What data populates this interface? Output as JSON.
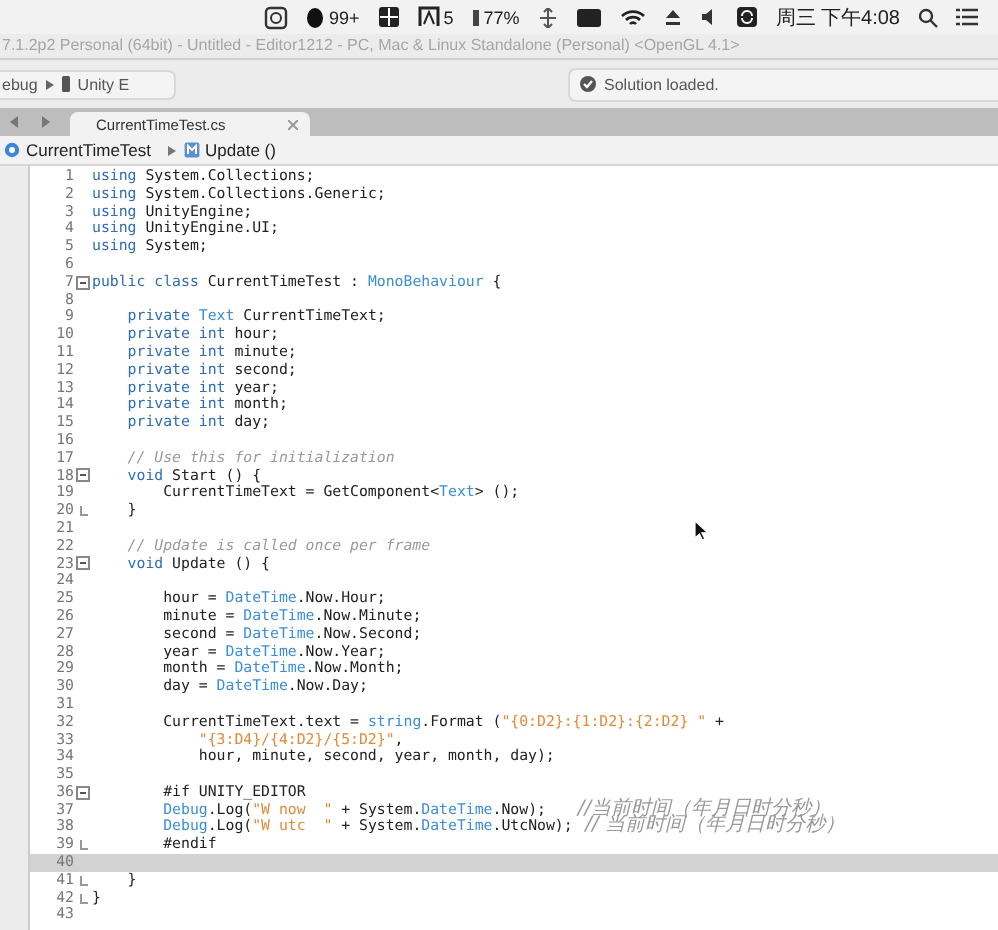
{
  "menubar": {
    "items": [
      {
        "kind": "window"
      },
      {
        "kind": "figure",
        "text": "99+"
      },
      {
        "kind": "grid"
      },
      {
        "kind": "letters",
        "text": "5"
      },
      {
        "kind": "meter",
        "text": "77%"
      },
      {
        "kind": "network"
      },
      {
        "kind": "display"
      },
      {
        "kind": "wifi"
      },
      {
        "kind": "eject"
      },
      {
        "kind": "volume"
      },
      {
        "kind": "sync"
      }
    ],
    "clock": "周三 下午4:08"
  },
  "window": {
    "title": "7.1.2p2 Personal (64bit) - Untitled - Editor1212 - PC, Mac & Linux Standalone (Personal) <OpenGL 4.1>"
  },
  "toolbar": {
    "config": "ebug",
    "target": "Unity E",
    "status": "Solution loaded."
  },
  "tabs": [
    {
      "label": "CurrentTimeTest.cs",
      "selected": true
    }
  ],
  "breadcrumb": [
    {
      "kind": "class",
      "label": "CurrentTimeTest"
    },
    {
      "kind": "method",
      "label": "Update ()"
    }
  ],
  "code": {
    "lines": [
      {
        "number": "1",
        "current": false,
        "tokens": [
          {
            "kind": "keyword",
            "text": "using"
          },
          {
            "kind": "plain",
            "text": " System.Collections;"
          }
        ]
      },
      {
        "number": "2",
        "current": false,
        "tokens": [
          {
            "kind": "keyword",
            "text": "using"
          },
          {
            "kind": "plain",
            "text": " System.Collections.Generic;"
          }
        ]
      },
      {
        "number": "3",
        "current": false,
        "tokens": [
          {
            "kind": "keyword",
            "text": "using"
          },
          {
            "kind": "plain",
            "text": " UnityEngine;"
          }
        ]
      },
      {
        "number": "4",
        "current": false,
        "tokens": [
          {
            "kind": "keyword",
            "text": "using"
          },
          {
            "kind": "plain",
            "text": " UnityEngine.UI;"
          }
        ]
      },
      {
        "number": "5",
        "current": false,
        "tokens": [
          {
            "kind": "keyword",
            "text": "using"
          },
          {
            "kind": "plain",
            "text": " System;"
          }
        ]
      },
      {
        "number": "6",
        "current": false
      },
      {
        "number": "7",
        "current": false,
        "kind": "fold_start",
        "tokens": [
          {
            "kind": "keyword",
            "text": "public class"
          },
          {
            "kind": "plain",
            "text": " CurrentTimeTest :"
          },
          {
            "kind": "type",
            "text": " MonoBehaviour"
          },
          {
            "kind": "plain",
            "text": " {"
          }
        ]
      },
      {
        "number": "8",
        "current": false
      },
      {
        "number": "9",
        "current": false,
        "tokens": [
          {
            "kind": "keyword",
            "text": "    private"
          },
          {
            "kind": "type",
            "text": " Text"
          },
          {
            "kind": "plain",
            "text": " CurrentTimeText;"
          }
        ]
      },
      {
        "number": "10",
        "current": false,
        "tokens": [
          {
            "kind": "keyword",
            "text": "    private int"
          },
          {
            "kind": "plain",
            "text": " hour;"
          }
        ]
      },
      {
        "number": "11",
        "current": false,
        "tokens": [
          {
            "kind": "keyword",
            "text": "    private int"
          },
          {
            "kind": "plain",
            "text": " minute;"
          }
        ]
      },
      {
        "number": "12",
        "current": false,
        "tokens": [
          {
            "kind": "keyword",
            "text": "    private int"
          },
          {
            "kind": "plain",
            "text": " second;"
          }
        ]
      },
      {
        "number": "13",
        "current": false,
        "tokens": [
          {
            "kind": "keyword",
            "text": "    private int"
          },
          {
            "kind": "plain",
            "text": " year;"
          }
        ]
      },
      {
        "number": "14",
        "current": false,
        "tokens": [
          {
            "kind": "keyword",
            "text": "    private int"
          },
          {
            "kind": "plain",
            "text": " month;"
          }
        ]
      },
      {
        "number": "15",
        "current": false,
        "tokens": [
          {
            "kind": "keyword",
            "text": "    private int"
          },
          {
            "kind": "plain",
            "text": " day;"
          }
        ]
      },
      {
        "number": "16",
        "current": false
      },
      {
        "number": "17",
        "current": false,
        "tokens": [
          {
            "kind": "comment",
            "text": "    // Use this for initialization"
          }
        ]
      },
      {
        "number": "18",
        "current": false,
        "kind": "fold_start",
        "tokens": [
          {
            "kind": "keyword",
            "text": "    void"
          },
          {
            "kind": "plain",
            "text": " Start () {"
          }
        ]
      },
      {
        "number": "19",
        "current": false,
        "tokens": [
          {
            "kind": "plain",
            "text": "        CurrentTimeText = GetComponent<"
          },
          {
            "kind": "type",
            "text": "Text"
          },
          {
            "kind": "plain",
            "text": "> ();"
          }
        ]
      },
      {
        "number": "20",
        "current": false,
        "kind": "fold_end",
        "tokens": [
          {
            "kind": "plain",
            "text": "    }"
          }
        ]
      },
      {
        "number": "21",
        "current": false
      },
      {
        "number": "22",
        "current": false,
        "tokens": [
          {
            "kind": "comment",
            "text": "    // Update is called once per frame"
          }
        ]
      },
      {
        "number": "23",
        "current": false,
        "kind": "fold_start",
        "tokens": [
          {
            "kind": "keyword",
            "text": "    void"
          },
          {
            "kind": "plain",
            "text": " Update () {"
          }
        ]
      },
      {
        "number": "24",
        "current": false
      },
      {
        "number": "25",
        "current": false,
        "tokens": [
          {
            "kind": "plain",
            "text": "        hour ="
          },
          {
            "kind": "type",
            "text": " DateTime"
          },
          {
            "kind": "plain",
            "text": ".Now.Hour;"
          }
        ]
      },
      {
        "number": "26",
        "current": false,
        "tokens": [
          {
            "kind": "plain",
            "text": "        minute ="
          },
          {
            "kind": "type",
            "text": " DateTime"
          },
          {
            "kind": "plain",
            "text": ".Now.Minute;"
          }
        ]
      },
      {
        "number": "27",
        "current": false,
        "tokens": [
          {
            "kind": "plain",
            "text": "        second ="
          },
          {
            "kind": "type",
            "text": " DateTime"
          },
          {
            "kind": "plain",
            "text": ".Now.Second;"
          }
        ]
      },
      {
        "number": "28",
        "current": false,
        "tokens": [
          {
            "kind": "plain",
            "text": "        year ="
          },
          {
            "kind": "type",
            "text": " DateTime"
          },
          {
            "kind": "plain",
            "text": ".Now.Year;"
          }
        ]
      },
      {
        "number": "29",
        "current": false,
        "tokens": [
          {
            "kind": "plain",
            "text": "        month ="
          },
          {
            "kind": "type",
            "text": " DateTime"
          },
          {
            "kind": "plain",
            "text": ".Now.Month;"
          }
        ]
      },
      {
        "number": "30",
        "current": false,
        "tokens": [
          {
            "kind": "plain",
            "text": "        day ="
          },
          {
            "kind": "type",
            "text": " DateTime"
          },
          {
            "kind": "plain",
            "text": ".Now.Day;"
          }
        ]
      },
      {
        "number": "31",
        "current": false
      },
      {
        "number": "32",
        "current": false,
        "tokens": [
          {
            "kind": "plain",
            "text": "        CurrentTimeText.text ="
          },
          {
            "kind": "type",
            "text": " string"
          },
          {
            "kind": "plain",
            "text": ".Format ("
          },
          {
            "kind": "string",
            "text": "\"{0:D2}:{1:D2}:{2:D2} \""
          },
          {
            "kind": "plain",
            "text": " +"
          }
        ]
      },
      {
        "number": "33",
        "current": false,
        "tokens": [
          {
            "kind": "string",
            "text": "            \"{3:D4}/{4:D2}/{5:D2}\""
          },
          {
            "kind": "plain",
            "text": ","
          }
        ]
      },
      {
        "number": "34",
        "current": false,
        "tokens": [
          {
            "kind": "plain",
            "text": "            hour, minute, second, year, month, day);"
          }
        ]
      },
      {
        "number": "35",
        "current": false
      },
      {
        "number": "36",
        "current": false,
        "kind": "fold_start",
        "tokens": [
          {
            "kind": "plain",
            "text": "        #if UNITY_EDITOR"
          }
        ]
      },
      {
        "number": "37",
        "current": false,
        "tokens": [
          {
            "kind": "type",
            "text": "        Debug"
          },
          {
            "kind": "plain",
            "text": ".Log("
          },
          {
            "kind": "string",
            "text": "\"W now  \""
          },
          {
            "kind": "plain",
            "text": " + System."
          },
          {
            "kind": "type",
            "text": "DateTime"
          },
          {
            "kind": "plain",
            "text": ".Now);"
          },
          {
            "kind": "comment",
            "text": "     //当前时间（年月日时分秒）"
          }
        ]
      },
      {
        "number": "38",
        "current": false,
        "tokens": [
          {
            "kind": "type",
            "text": "        Debug"
          },
          {
            "kind": "plain",
            "text": ".Log("
          },
          {
            "kind": "string",
            "text": "\"W utc  \""
          },
          {
            "kind": "plain",
            "text": " + System."
          },
          {
            "kind": "type",
            "text": "DateTime"
          },
          {
            "kind": "plain",
            "text": ".UtcNow);"
          },
          {
            "kind": "comment",
            "text": "  // 当前时间（年月日时分秒）"
          }
        ]
      },
      {
        "number": "39",
        "current": false,
        "kind": "fold_end",
        "tokens": [
          {
            "kind": "plain",
            "text": "        #endif"
          }
        ]
      },
      {
        "number": "40",
        "current": true
      },
      {
        "number": "41",
        "current": false,
        "kind": "fold_end",
        "tokens": [
          {
            "kind": "plain",
            "text": "    }"
          }
        ]
      },
      {
        "number": "42",
        "current": false,
        "kind": "fold_end",
        "tokens": [
          {
            "kind": "plain",
            "text": "}"
          }
        ]
      },
      {
        "number": "43",
        "current": false
      }
    ]
  }
}
